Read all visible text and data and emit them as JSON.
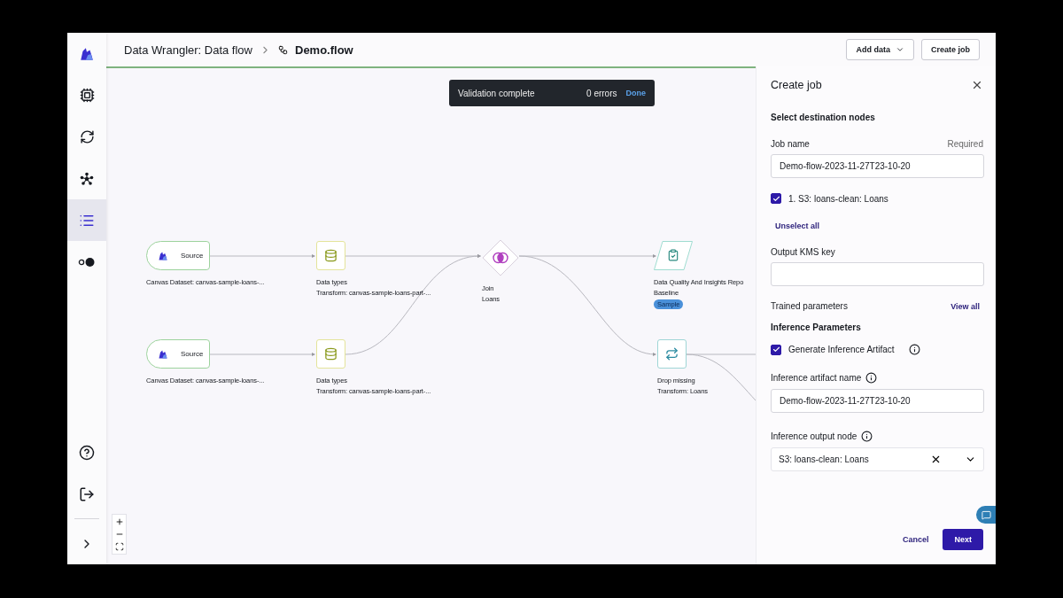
{
  "sidebar": {
    "items": [
      {
        "selected": false
      },
      {
        "selected": false
      },
      {
        "selected": false
      },
      {
        "selected": true
      },
      {
        "selected": false
      }
    ]
  },
  "header": {
    "breadcrumb": "Data Wrangler: Data flow",
    "file": "Demo.flow",
    "buttons": [
      {
        "label": "Add data",
        "kind": "dropdown"
      },
      {
        "label": "Create job",
        "kind": "plain"
      }
    ]
  },
  "toast": {
    "title": "Validation complete",
    "errors": "0 errors",
    "action": "Done"
  },
  "nodes": [
    {
      "kind": "source",
      "label": "Source",
      "title": "Canvas Dataset: canvas-sample-loans-..."
    },
    {
      "kind": "types",
      "title": "Data types",
      "subtitle": "Transform: canvas-sample-loans-part-..."
    },
    {
      "kind": "join",
      "title": "Join",
      "subtitle": "Loans"
    },
    {
      "kind": "report",
      "title": "Data Quality And Insights Repo",
      "subtitle": "Baseline",
      "badge": "Sample"
    },
    {
      "kind": "source",
      "label": "Source",
      "title": "Canvas Dataset: canvas-sample-loans-..."
    },
    {
      "kind": "types",
      "title": "Data types",
      "subtitle": "Transform: canvas-sample-loans-part-..."
    },
    {
      "kind": "drop",
      "title": "Drop missing",
      "subtitle": "Transform: Loans"
    }
  ],
  "panel": {
    "title": "Create job",
    "section": "Select destination nodes",
    "job_name": {
      "label": "Job name",
      "hint": "Required",
      "value": "Demo-flow-2023-11-27T23-10-20"
    },
    "destinations": [
      {
        "label": "1. S3: loans-clean: Loans",
        "checked": true
      }
    ],
    "unselect": "Unselect all",
    "kms": {
      "label": "Output KMS key"
    },
    "trained": {
      "label": "Trained parameters",
      "link": "View all"
    },
    "inference_heading": "Inference Parameters",
    "generate": {
      "label": "Generate Inference Artifact",
      "checked": true
    },
    "artifact": {
      "label": "Inference artifact name",
      "value": "Demo-flow-2023-11-27T23-10-20"
    },
    "output_node": {
      "label": "Inference output node",
      "value": "S3: loans-clean: Loans"
    },
    "cancel": "Cancel",
    "next": "Next"
  }
}
